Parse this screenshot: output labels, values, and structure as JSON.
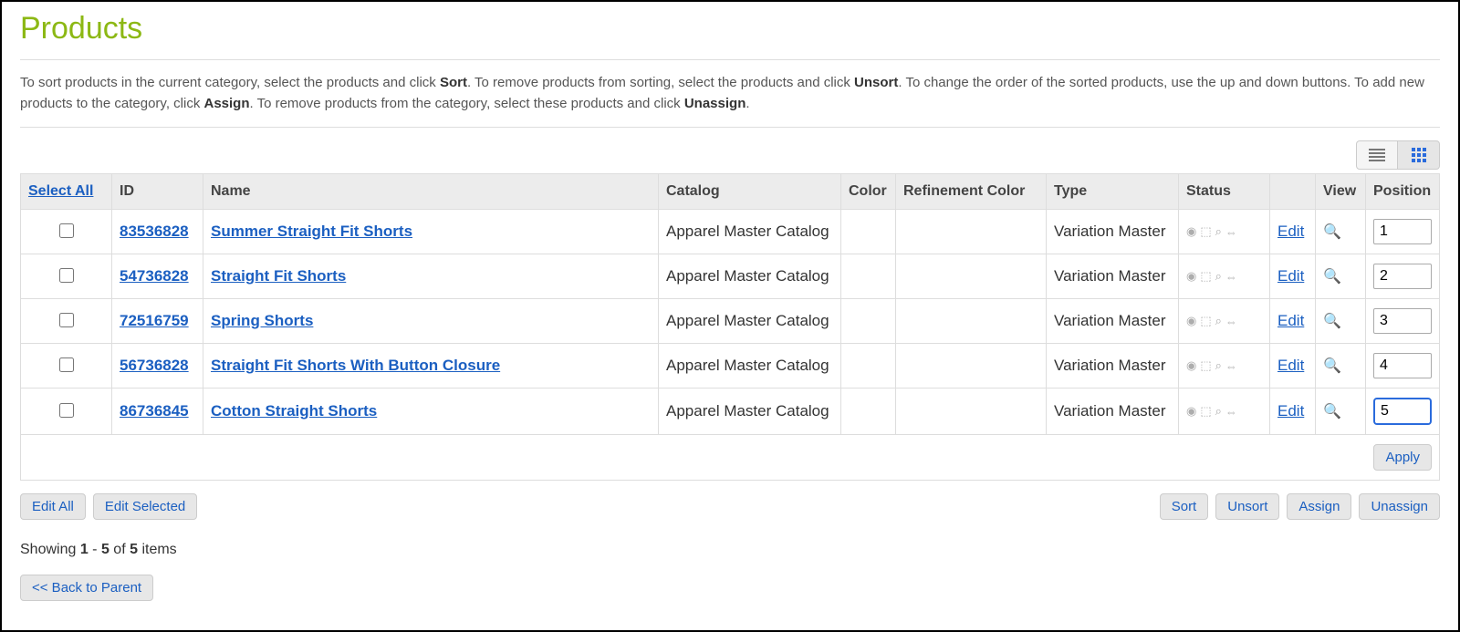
{
  "page": {
    "title": "Products",
    "intro_parts": {
      "p1": "To sort products in the current category, select the products and click ",
      "b1": "Sort",
      "p2": ". To remove products from sorting, select the products and click ",
      "b2": "Unsort",
      "p3": ". To change the order of the sorted products, use the up and down buttons. To add new products to the category, click ",
      "b3": "Assign",
      "p4": ". To remove products from the category, select these products and click ",
      "b4": "Unassign",
      "p5": "."
    }
  },
  "table": {
    "headers": {
      "select_all": "Select All",
      "id": "ID",
      "name": "Name",
      "catalog": "Catalog",
      "color": "Color",
      "refinement_color": "Refinement Color",
      "type": "Type",
      "status": "Status",
      "view": "View",
      "position": "Position"
    },
    "rows": [
      {
        "id": "83536828",
        "name": "Summer Straight Fit Shorts",
        "catalog": "Apparel Master Catalog",
        "color": "",
        "refinement_color": "",
        "type": "Variation Master",
        "position": "1",
        "edit": "Edit"
      },
      {
        "id": "54736828",
        "name": "Straight Fit Shorts",
        "catalog": "Apparel Master Catalog",
        "color": "",
        "refinement_color": "",
        "type": "Variation Master",
        "position": "2",
        "edit": "Edit"
      },
      {
        "id": "72516759",
        "name": "Spring Shorts",
        "catalog": "Apparel Master Catalog",
        "color": "",
        "refinement_color": "",
        "type": "Variation Master",
        "position": "3",
        "edit": "Edit"
      },
      {
        "id": "56736828",
        "name": "Straight Fit Shorts With Button Closure",
        "catalog": "Apparel Master Catalog",
        "color": "",
        "refinement_color": "",
        "type": "Variation Master",
        "position": "4",
        "edit": "Edit"
      },
      {
        "id": "86736845",
        "name": "Cotton Straight Shorts",
        "catalog": "Apparel Master Catalog",
        "color": "",
        "refinement_color": "",
        "type": "Variation Master",
        "position": "5",
        "edit": "Edit"
      }
    ],
    "apply_label": "Apply"
  },
  "actions": {
    "edit_all": "Edit All",
    "edit_selected": "Edit Selected",
    "sort": "Sort",
    "unsort": "Unsort",
    "assign": "Assign",
    "unassign": "Unassign"
  },
  "pagination": {
    "prefix": "Showing ",
    "from": "1",
    "dash": " - ",
    "to": "5",
    "of": " of ",
    "total": "5",
    "suffix": " items"
  },
  "back_button": "<< Back to Parent",
  "focused_row_index": 4
}
